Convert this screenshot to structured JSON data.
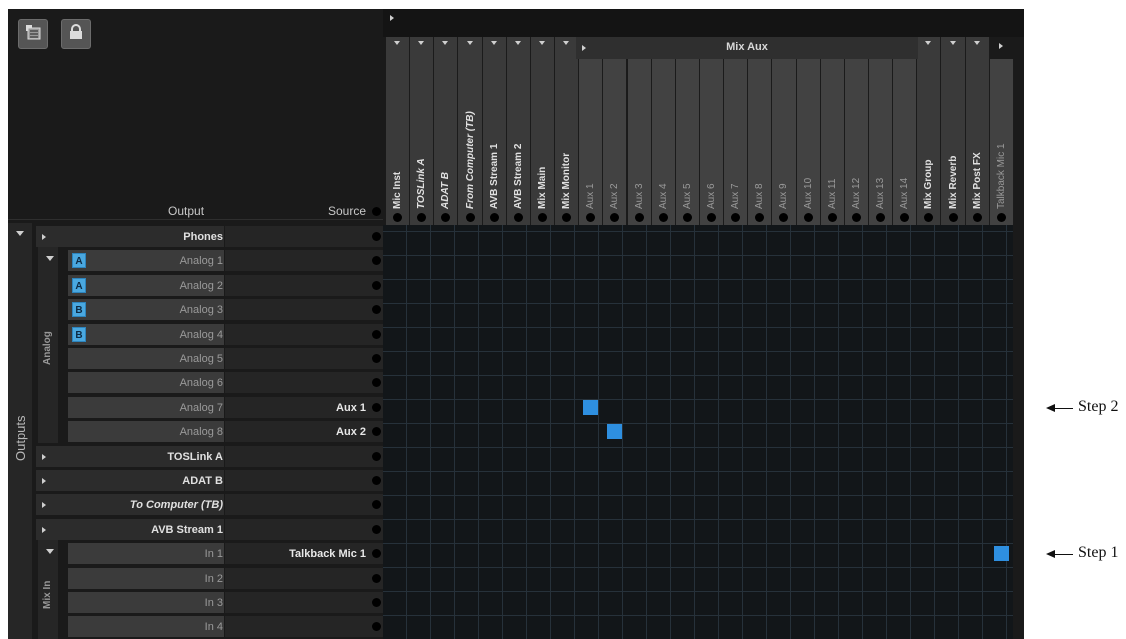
{
  "toolbar": {
    "list_icon": "list-icon",
    "lock_icon": "lock-icon"
  },
  "headers": {
    "output": "Output",
    "source": "Source",
    "mix_aux": "Mix Aux"
  },
  "columns": [
    {
      "label": "Mic Inst",
      "style": "bold"
    },
    {
      "label": "TOSLink A",
      "style": "bold-italic"
    },
    {
      "label": "ADAT B",
      "style": "bold-italic"
    },
    {
      "label": "From Computer (TB)",
      "style": "bold-italic"
    },
    {
      "label": "AVB Stream 1",
      "style": "bold"
    },
    {
      "label": "AVB Stream 2",
      "style": "bold"
    },
    {
      "label": "Mix Main",
      "style": "bold"
    },
    {
      "label": "Mix Monitor",
      "style": "bold"
    },
    {
      "label": "Aux 1",
      "style": "aux"
    },
    {
      "label": "Aux 2",
      "style": "aux"
    },
    {
      "label": "Aux 3",
      "style": "aux"
    },
    {
      "label": "Aux 4",
      "style": "aux"
    },
    {
      "label": "Aux 5",
      "style": "aux"
    },
    {
      "label": "Aux 6",
      "style": "aux"
    },
    {
      "label": "Aux 7",
      "style": "aux"
    },
    {
      "label": "Aux 8",
      "style": "aux"
    },
    {
      "label": "Aux 9",
      "style": "aux"
    },
    {
      "label": "Aux 10",
      "style": "aux"
    },
    {
      "label": "Aux 11",
      "style": "aux"
    },
    {
      "label": "Aux 12",
      "style": "aux"
    },
    {
      "label": "Aux 13",
      "style": "aux"
    },
    {
      "label": "Aux 14",
      "style": "aux"
    },
    {
      "label": "Mix Group",
      "style": "bold"
    },
    {
      "label": "Mix Reverb",
      "style": "bold"
    },
    {
      "label": "Mix Post FX",
      "style": "bold"
    },
    {
      "label": "Talkback Mic 1",
      "style": "aux"
    }
  ],
  "side": {
    "outputs_label": "Outputs",
    "analog_label": "Analog",
    "mixin_label": "Mix In"
  },
  "rows": [
    {
      "label": "Phones",
      "type": "group",
      "source": ""
    },
    {
      "label": "Analog 1",
      "type": "sub",
      "badge": "A",
      "source": ""
    },
    {
      "label": "Analog 2",
      "type": "sub",
      "badge": "A",
      "source": ""
    },
    {
      "label": "Analog 3",
      "type": "sub",
      "badge": "B",
      "source": ""
    },
    {
      "label": "Analog 4",
      "type": "sub",
      "badge": "B",
      "source": ""
    },
    {
      "label": "Analog 5",
      "type": "sub",
      "badge": "",
      "source": ""
    },
    {
      "label": "Analog 6",
      "type": "sub",
      "badge": "",
      "source": ""
    },
    {
      "label": "Analog 7",
      "type": "sub",
      "badge": "",
      "source": "Aux 1"
    },
    {
      "label": "Analog 8",
      "type": "sub",
      "badge": "",
      "source": "Aux 2"
    },
    {
      "label": "TOSLink A",
      "type": "group",
      "source": ""
    },
    {
      "label": "ADAT B",
      "type": "group",
      "source": ""
    },
    {
      "label": "To Computer (TB)",
      "type": "group-italic",
      "source": ""
    },
    {
      "label": "AVB Stream 1",
      "type": "group",
      "source": ""
    },
    {
      "label": "In 1",
      "type": "sub",
      "badge": "",
      "source": "Talkback Mic 1"
    },
    {
      "label": "In 2",
      "type": "sub",
      "badge": "",
      "source": ""
    },
    {
      "label": "In 3",
      "type": "sub",
      "badge": "",
      "source": ""
    },
    {
      "label": "In 4",
      "type": "sub",
      "badge": "",
      "source": ""
    }
  ],
  "patches": [
    {
      "row": 7,
      "col": 8
    },
    {
      "row": 8,
      "col": 9
    },
    {
      "row": 13,
      "col": 25
    }
  ],
  "annotations": [
    {
      "label": "Step 2",
      "row": 7
    },
    {
      "label": "Step 1",
      "row": 13
    }
  ],
  "colors": {
    "patch": "#2e8fe0",
    "badge": "#4aa8e0"
  }
}
